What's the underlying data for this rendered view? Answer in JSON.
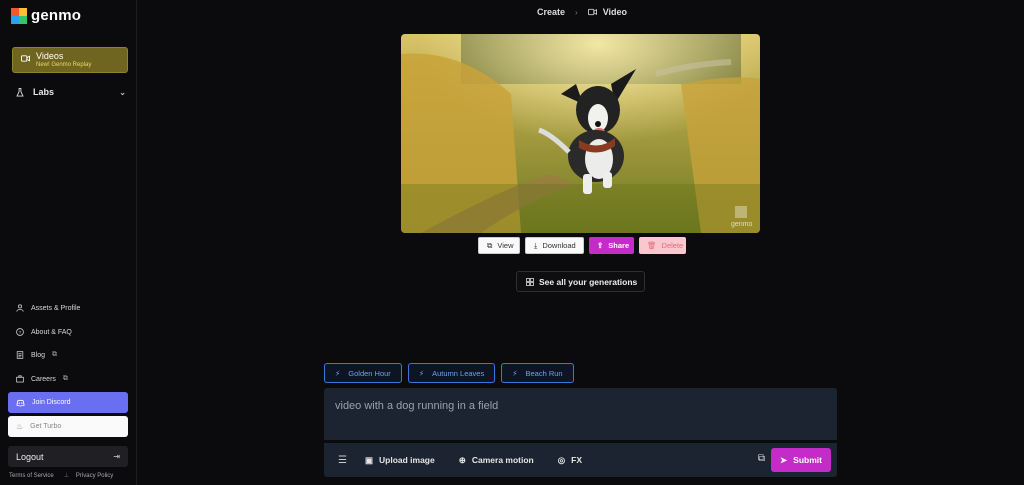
{
  "brand": {
    "name": "genmo"
  },
  "sidebar": {
    "videos": {
      "label": "Videos",
      "sublabel": "New! Genmo Replay"
    },
    "labs": {
      "label": "Labs"
    },
    "links": [
      {
        "label": "Assets & Profile"
      },
      {
        "label": "About & FAQ"
      },
      {
        "label": "Blog"
      },
      {
        "label": "Careers"
      }
    ],
    "discord_label": "Join Discord",
    "turbo_label": "Get Turbo",
    "logout_label": "Logout",
    "terms_label": "Terms of Service",
    "privacy_label": "Privacy Policy"
  },
  "breadcrumb": {
    "root": "Create",
    "current": "Video"
  },
  "video": {
    "watermark": "genmo"
  },
  "actions": {
    "view": "View",
    "download": "Download",
    "share": "Share",
    "delete": "Delete"
  },
  "see_all_label": "See all your generations",
  "chips": [
    "Golden Hour",
    "Autumn Leaves",
    "Beach Run"
  ],
  "prompt": {
    "text": "video with a dog running in a field"
  },
  "toolbar": {
    "upload": "Upload image",
    "camera": "Camera motion",
    "fx": "FX",
    "submit": "Submit"
  },
  "colors": {
    "accent": "#c52bc9",
    "discord": "#6a6ef0",
    "videos_bg": "#6f6420",
    "chip_blue": "#3a78d8"
  }
}
